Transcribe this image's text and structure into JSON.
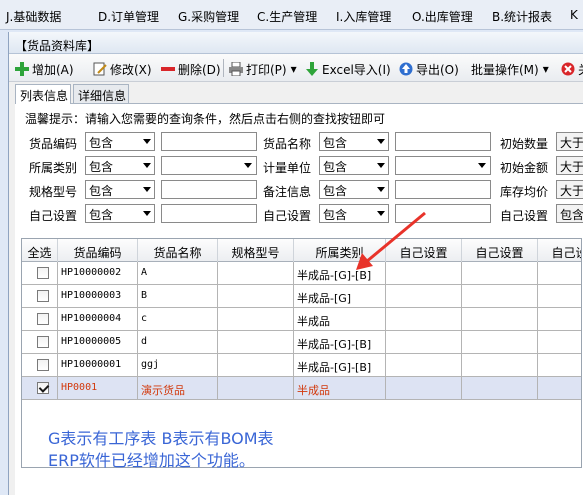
{
  "menubar": {
    "items": [
      {
        "label": "J.基础数据"
      },
      {
        "label": "D.订单管理"
      },
      {
        "label": "G.采购管理"
      },
      {
        "label": "C.生产管理"
      },
      {
        "label": "I.入库管理"
      },
      {
        "label": "O.出库管理"
      },
      {
        "label": "B.统计报表"
      },
      {
        "label": "K"
      }
    ]
  },
  "window": {
    "title": "【货品资料库】"
  },
  "toolbar": {
    "add": "增加(A)",
    "edit": "修改(X)",
    "delete": "删除(D)",
    "print": "打印(P)",
    "excel_import": "Excel导入(I)",
    "export": "导出(O)",
    "batch": "批量操作(M)",
    "close": "关"
  },
  "tabs": [
    "列表信息",
    "详细信息"
  ],
  "hint": "温馨提示：请输入您需要的查询条件，然后点击右侧的查找按钮即可",
  "query": {
    "rows": [
      {
        "l1": "货品编码",
        "s1": "包含",
        "l2": "货品名称",
        "s2": "包含",
        "l3": "初始数量",
        "b3": "大于"
      },
      {
        "l1": "所属类别",
        "s1": "包含",
        "l2": "计量单位",
        "s2": "包含",
        "l3": "初始金额",
        "b3": "大于"
      },
      {
        "l1": "规格型号",
        "s1": "包含",
        "l2": "备注信息",
        "s2": "包含",
        "l3": "库存均价",
        "b3": "大于"
      },
      {
        "l1": "自己设置",
        "s1": "包含",
        "l2": "自己设置",
        "s2": "包含",
        "l3": "自己设置",
        "b3": "包含"
      }
    ]
  },
  "grid": {
    "headers": [
      "全选",
      "货品编码",
      "货品名称",
      "规格型号",
      "所属类别",
      "自己设置",
      "自己设置",
      "自己设置"
    ],
    "rows": [
      {
        "code": "HP10000002",
        "name": "A",
        "spec": "",
        "category": "半成品-[G]-[B]",
        "checked": false,
        "selected": false
      },
      {
        "code": "HP10000003",
        "name": "B",
        "spec": "",
        "category": "半成品-[G]",
        "checked": false,
        "selected": false
      },
      {
        "code": "HP10000004",
        "name": "c",
        "spec": "",
        "category": "半成品",
        "checked": false,
        "selected": false
      },
      {
        "code": "HP10000005",
        "name": "d",
        "spec": "",
        "category": "半成品-[G]-[B]",
        "checked": false,
        "selected": false
      },
      {
        "code": "HP10000001",
        "name": "ggj",
        "spec": "",
        "category": "半成品-[G]-[B]",
        "checked": false,
        "selected": false
      },
      {
        "code": "HP0001",
        "name": "演示货品",
        "spec": "",
        "category": "半成品",
        "checked": true,
        "selected": true
      }
    ]
  },
  "note": {
    "line1": "G表示有工序表 B表示有BOM表",
    "line2": "ERP软件已经增加这个功能。"
  },
  "colors": {
    "note": "#3a66d6",
    "arrow": "#e8332a",
    "selected_text": "#d2380b"
  }
}
